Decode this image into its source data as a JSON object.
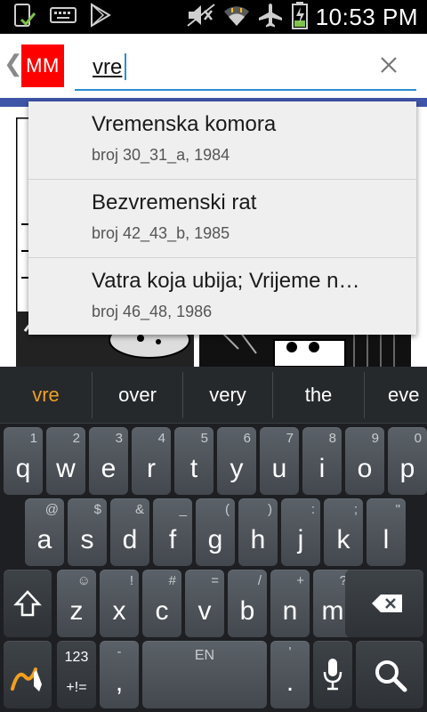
{
  "status_bar": {
    "time": "10:53 PM",
    "left_icons": [
      "check-screen-icon",
      "keyboard-icon",
      "play-store-icon"
    ],
    "right_icons": [
      "mute-icon",
      "wifi-icon",
      "airplane-icon",
      "battery-charging-icon"
    ]
  },
  "action_bar": {
    "logo_text": "MM",
    "search_value": "vre",
    "clear_icon": "close-icon"
  },
  "suggestions": [
    {
      "title": "Vremenska komora",
      "subtitle": "broj 30_31_a, 1984"
    },
    {
      "title": "Bezvremenski rat",
      "subtitle": "broj 42_43_b, 1985"
    },
    {
      "title": "Vatra koja ubija; Vrijeme n…",
      "subtitle": "broj 46_48, 1986"
    }
  ],
  "keyboard": {
    "word_suggestions": [
      "vre",
      "over",
      "very",
      "the",
      "eve"
    ],
    "row1": [
      {
        "main": "q",
        "alt": "1"
      },
      {
        "main": "w",
        "alt": "2"
      },
      {
        "main": "e",
        "alt": "3"
      },
      {
        "main": "r",
        "alt": "4"
      },
      {
        "main": "t",
        "alt": "5"
      },
      {
        "main": "y",
        "alt": "6"
      },
      {
        "main": "u",
        "alt": "7"
      },
      {
        "main": "i",
        "alt": "8"
      },
      {
        "main": "o",
        "alt": "9"
      },
      {
        "main": "p",
        "alt": "0"
      }
    ],
    "row2": [
      {
        "main": "a",
        "alt": "@"
      },
      {
        "main": "s",
        "alt": "$"
      },
      {
        "main": "d",
        "alt": "&"
      },
      {
        "main": "f",
        "alt": "_"
      },
      {
        "main": "g",
        "alt": "("
      },
      {
        "main": "h",
        "alt": ")"
      },
      {
        "main": "j",
        "alt": ":"
      },
      {
        "main": "k",
        "alt": ";"
      },
      {
        "main": "l",
        "alt": "\""
      }
    ],
    "row3": [
      {
        "main": "z",
        "alt": "☺"
      },
      {
        "main": "x",
        "alt": "!"
      },
      {
        "main": "c",
        "alt": "#"
      },
      {
        "main": "v",
        "alt": "="
      },
      {
        "main": "b",
        "alt": "/"
      },
      {
        "main": "n",
        "alt": "+"
      },
      {
        "main": "m",
        "alt": "?"
      }
    ],
    "sym_top": "123",
    "sym_bottom": "+!=",
    "comma": ",",
    "comma_alt": "-",
    "space_label": "EN",
    "period": ".",
    "period_alt": "'"
  }
}
